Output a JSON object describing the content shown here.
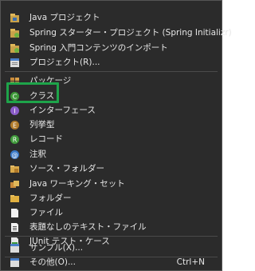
{
  "menu": {
    "items": [
      {
        "label": "Java プロジェクト",
        "icon": "java-project-icon"
      },
      {
        "label": "Spring スターター・プロジェクト (Spring Initializr)",
        "icon": "spring-starter-project-icon"
      },
      {
        "label": "Spring 入門コンテンツのインポート",
        "icon": "spring-import-content-icon"
      },
      {
        "label": "プロジェクト(R)...",
        "icon": "project-icon"
      },
      {
        "label": "パッケージ",
        "icon": "package-icon"
      },
      {
        "label": "クラス",
        "icon": "class-icon"
      },
      {
        "label": "インターフェース",
        "icon": "interface-icon"
      },
      {
        "label": "列挙型",
        "icon": "enum-icon"
      },
      {
        "label": "レコード",
        "icon": "record-icon"
      },
      {
        "label": "注釈",
        "icon": "annotation-icon"
      },
      {
        "label": "ソース・フォルダー",
        "icon": "source-folder-icon"
      },
      {
        "label": "Java ワーキング・セット",
        "icon": "working-set-icon"
      },
      {
        "label": "フォルダー",
        "icon": "folder-icon"
      },
      {
        "label": "ファイル",
        "icon": "file-icon"
      },
      {
        "label": "表題なしのテキスト・ファイル",
        "icon": "untitled-text-file-icon"
      },
      {
        "label": "JUnit テスト・ケース",
        "icon": "junit-test-case-icon"
      },
      {
        "label": "サンプル(X)...",
        "icon": "example-icon"
      },
      {
        "label": "その他(O)...",
        "icon": "other-icon",
        "shortcut": "Ctrl+N"
      }
    ]
  },
  "colors": {
    "menu_background": "#2b2b2b",
    "text": "#e6e6e6",
    "highlight": "#1ea44a"
  }
}
